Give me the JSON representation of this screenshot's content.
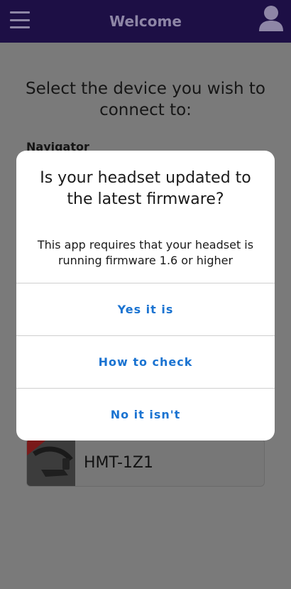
{
  "header": {
    "title": "Welcome",
    "menu_icon": "hamburger-menu-icon",
    "profile_icon": "user-profile-icon",
    "background": "#1d0f45"
  },
  "main": {
    "heading": "Select the device you wish to connect to:",
    "section_label": "Navigator",
    "devices": [
      {
        "name": "HMT-1Z1",
        "icon": "headset-device-thumbnail"
      }
    ]
  },
  "dialog": {
    "title": "Is your headset updated to the latest firmware?",
    "message": "This app requires that your headset is running firmware 1.6 or higher",
    "buttons": {
      "yes": "Yes it is",
      "how": "How to check",
      "no": "No it isn't"
    },
    "button_color": "#1a73d1"
  }
}
